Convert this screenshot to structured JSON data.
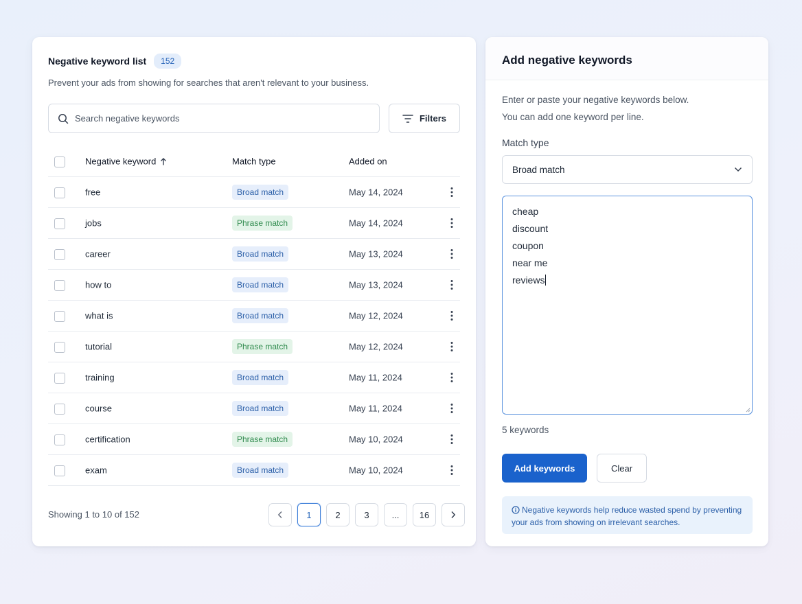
{
  "colors": {
    "accent": "#1a62cc",
    "broad_bg": "#e6eefb",
    "broad_text": "#2b5fa8",
    "phrase_bg": "#e3f4e8",
    "phrase_text": "#2f8a4d"
  },
  "list_panel": {
    "title": "Negative keyword list",
    "count": "152",
    "subtitle": "Prevent your ads from showing for searches that aren't relevant to your business.",
    "search": {
      "placeholder": "Search negative keywords",
      "icon": "search-icon"
    },
    "filters_label": "Filters",
    "columns": {
      "keyword": "Negative keyword",
      "match_type": "Match type",
      "added_on": "Added on"
    },
    "rows": [
      {
        "keyword": "free",
        "match_type": "Broad match",
        "added_on": "May 14, 2024"
      },
      {
        "keyword": "jobs",
        "match_type": "Phrase match",
        "added_on": "May 14, 2024"
      },
      {
        "keyword": "career",
        "match_type": "Broad match",
        "added_on": "May 13, 2024"
      },
      {
        "keyword": "how to",
        "match_type": "Broad match",
        "added_on": "May 13, 2024"
      },
      {
        "keyword": "what is",
        "match_type": "Broad match",
        "added_on": "May 12, 2024"
      },
      {
        "keyword": "tutorial",
        "match_type": "Phrase match",
        "added_on": "May 12, 2024"
      },
      {
        "keyword": "training",
        "match_type": "Broad match",
        "added_on": "May 11, 2024"
      },
      {
        "keyword": "course",
        "match_type": "Broad match",
        "added_on": "May 11, 2024"
      },
      {
        "keyword": "certification",
        "match_type": "Phrase match",
        "added_on": "May 10, 2024"
      },
      {
        "keyword": "exam",
        "match_type": "Broad match",
        "added_on": "May 10, 2024"
      }
    ],
    "showing_text": "Showing 1 to 10 of 152",
    "pagination": {
      "pages": [
        "1",
        "2",
        "3",
        "...",
        "16"
      ],
      "current": "1"
    }
  },
  "add_panel": {
    "title": "Add negative keywords",
    "description_line1": "Enter or paste your negative keywords below.",
    "description_line2": "You can add one keyword per line.",
    "match_type_label": "Match type",
    "match_type_value": "Broad match",
    "keywords": [
      "cheap",
      "discount",
      "coupon",
      "near me",
      "reviews"
    ],
    "keyword_count": "5 keywords",
    "add_button": "Add keywords",
    "clear_button": "Clear",
    "info_text": "Negative keywords help reduce wasted spend by preventing your ads from showing on irrelevant searches."
  }
}
